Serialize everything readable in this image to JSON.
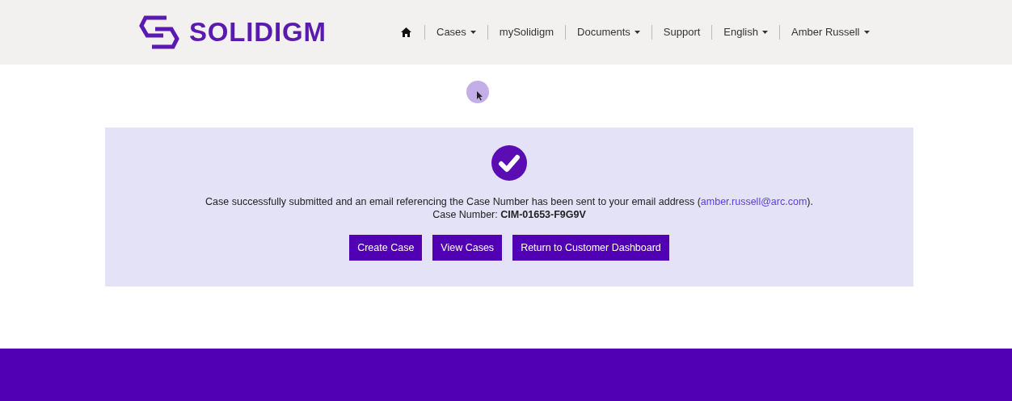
{
  "header": {
    "logo_text": "SOLIDIGM",
    "nav": [
      {
        "label": "Cases",
        "dropdown": true
      },
      {
        "label": "mySolidigm",
        "dropdown": false
      },
      {
        "label": "Documents",
        "dropdown": true
      },
      {
        "label": "Support",
        "dropdown": false
      },
      {
        "label": "English",
        "dropdown": true
      },
      {
        "label": "Amber Russell",
        "dropdown": true
      }
    ]
  },
  "confirmation": {
    "message_before": "Case successfully submitted and an email referencing the Case Number has been sent to your email address (",
    "email": "amber.russell@arc.com",
    "message_after": ").",
    "case_number": "Case Number: **CIM-01653-F9G9V**",
    "buttons": [
      "Create Case",
      "View Cases",
      "Return to Customer Dashboard"
    ]
  }
}
